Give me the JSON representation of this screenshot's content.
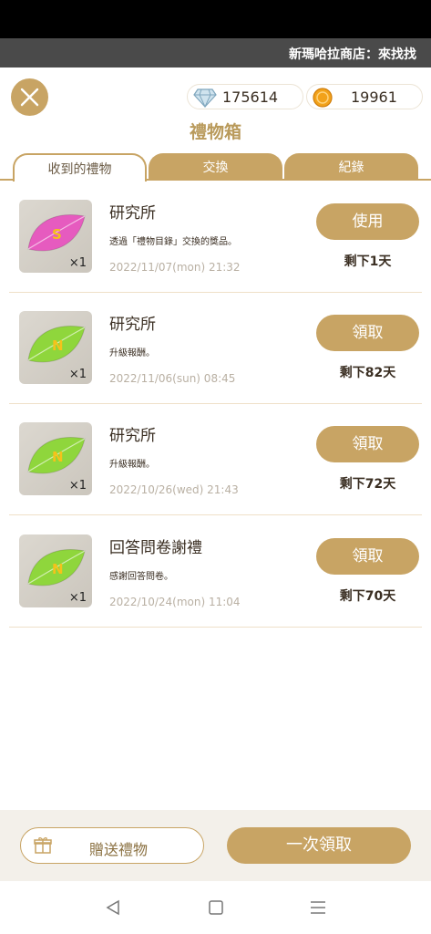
{
  "banner": {
    "text": "新瑪哈拉商店：來找找"
  },
  "currency": {
    "gems": "175614",
    "coins": "19961"
  },
  "title": "禮物箱",
  "tabs": [
    {
      "label": "收到的禮物"
    },
    {
      "label": "交換"
    },
    {
      "label": "紀錄"
    }
  ],
  "gifts": [
    {
      "name": "研究所",
      "desc": "透過「禮物目錄」交換的獎品。",
      "date": "2022/11/07(mon) 21:32",
      "button": "使用",
      "remaining": "剩下1天",
      "qty": "×1",
      "leaf_color": "#e65bbf"
    },
    {
      "name": "研究所",
      "desc": "升級報酬。",
      "date": "2022/11/06(sun) 08:45",
      "button": "領取",
      "remaining": "剩下82天",
      "qty": "×1",
      "leaf_color": "#8fd63c"
    },
    {
      "name": "研究所",
      "desc": "升級報酬。",
      "date": "2022/10/26(wed) 21:43",
      "button": "領取",
      "remaining": "剩下72天",
      "qty": "×1",
      "leaf_color": "#8fd63c"
    },
    {
      "name": "回答問卷謝禮",
      "desc": "感謝回答問卷。",
      "date": "2022/10/24(mon) 11:04",
      "button": "領取",
      "remaining": "剩下70天",
      "qty": "×1",
      "leaf_color": "#8fd63c"
    }
  ],
  "footer": {
    "send_label": "贈送禮物",
    "claim_all_label": "一次領取"
  },
  "colors": {
    "accent": "#c8a464",
    "title": "#b99a5b",
    "date": "#b9b0a3"
  }
}
